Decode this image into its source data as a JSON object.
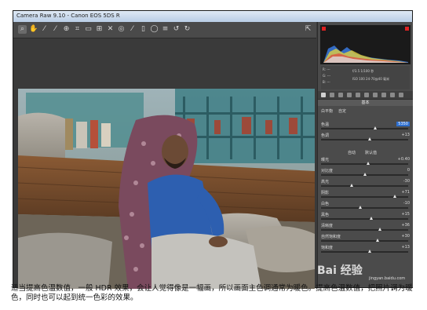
{
  "window": {
    "title": "Camera Raw 9.10 - Canon EOS 5DS R"
  },
  "toolbar": {
    "icons": [
      "zoom-icon",
      "hand-icon",
      "white-balance-icon",
      "color-sampler-icon",
      "target-adjust-icon",
      "crop-icon",
      "straighten-icon",
      "transform-icon",
      "spot-removal-icon",
      "red-eye-icon",
      "adjustment-brush-icon",
      "graduated-filter-icon",
      "radial-filter-icon",
      "preferences-icon",
      "rotate-ccw-icon",
      "rotate-cw-icon"
    ],
    "full_screen_label": "⇱"
  },
  "histogram": {
    "clip_warning_color": "#dd2222"
  },
  "meta": {
    "line1": "f/3.5   1/100 秒",
    "line2": "ISO 100   24-70@40 毫米",
    "rgb_r": "R:  ---",
    "rgb_g": "G:  ---",
    "rgb_b": "B:  ---"
  },
  "panel": {
    "section_title": "基本",
    "white_balance_label": "白平衡",
    "white_balance_value": "自定",
    "sliders": [
      {
        "label": "色温",
        "value": "5350",
        "position": 0.62,
        "highlight": true
      },
      {
        "label": "色调",
        "value": "+13",
        "position": 0.56
      },
      {
        "label": "曝光",
        "value": "+0.40",
        "position": 0.54
      },
      {
        "label": "对比度",
        "value": "0",
        "position": 0.5
      },
      {
        "label": "高光",
        "value": "-30",
        "position": 0.35
      },
      {
        "label": "阴影",
        "value": "+71",
        "position": 0.85
      },
      {
        "label": "白色",
        "value": "-10",
        "position": 0.45
      },
      {
        "label": "黑色",
        "value": "+15",
        "position": 0.58
      },
      {
        "label": "清晰度",
        "value": "+36",
        "position": 0.68
      },
      {
        "label": "自然饱和度",
        "value": "+30",
        "position": 0.65
      },
      {
        "label": "饱和度",
        "value": "+13",
        "position": 0.56
      }
    ],
    "auto_label": "自动",
    "default_label": "默认值"
  },
  "caption": {
    "text": "适当提高色温数值，一般 HDR 效果，会让人觉得像是一幅画，所以画面主色调通常为暖色。提高色温数值，把照片调为暖色，同时也可以起到统一色彩的效果。"
  },
  "watermark": {
    "brand": "Bai 经验",
    "url": "jingyan.baidu.com"
  }
}
